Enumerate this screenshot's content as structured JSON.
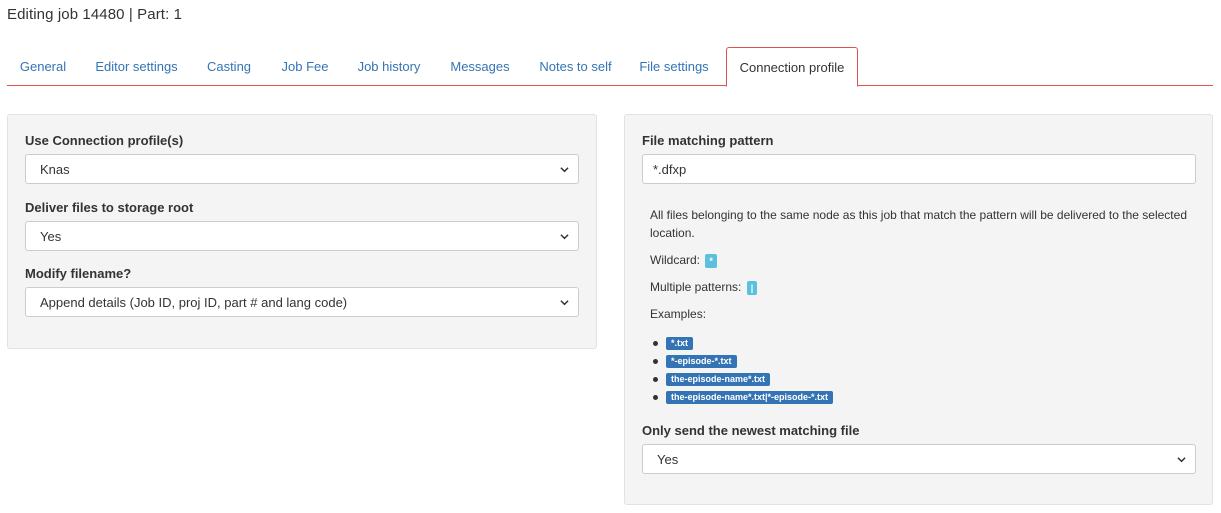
{
  "page_title": "Editing job 14480 | Part: 1",
  "tabs": [
    {
      "label": "General"
    },
    {
      "label": "Editor settings"
    },
    {
      "label": "Casting"
    },
    {
      "label": "Job Fee"
    },
    {
      "label": "Job history"
    },
    {
      "label": "Messages"
    },
    {
      "label": "Notes to self"
    },
    {
      "label": "File settings"
    },
    {
      "label": "Connection profile",
      "active": true
    }
  ],
  "left_panel": {
    "use_connection_profile": {
      "label": "Use Connection profile(s)",
      "value": "Knas"
    },
    "deliver_to_root": {
      "label": "Deliver files to storage root",
      "value": "Yes"
    },
    "modify_filename": {
      "label": "Modify filename?",
      "value": "Append details (Job ID, proj ID, part # and lang code)"
    }
  },
  "right_panel": {
    "pattern_label": "File matching pattern",
    "pattern_value": "*.dfxp",
    "help_text": "All files belonging to the same node as this job that match the pattern will be delivered to the selected location.",
    "wildcard_label": "Wildcard:",
    "wildcard_badge": "*",
    "multiple_label": "Multiple patterns:",
    "multiple_badge": "|",
    "examples_label": "Examples:",
    "examples": [
      "*.txt",
      "*-episode-*.txt",
      "the-episode-name*.txt",
      "the-episode-name*.txt|*-episode-*.txt"
    ],
    "newest_label": "Only send the newest matching file",
    "newest_value": "Yes"
  },
  "colors": {
    "tab_link": "#3474b4",
    "tab_border": "#d9534f",
    "panel_bg": "#f4f4f4",
    "badge_light": "#5bc0de",
    "badge_dark": "#3474b4"
  },
  "icons": {
    "select_arrow": "chevron-down-icon",
    "list_bullet": "bullet-icon"
  }
}
